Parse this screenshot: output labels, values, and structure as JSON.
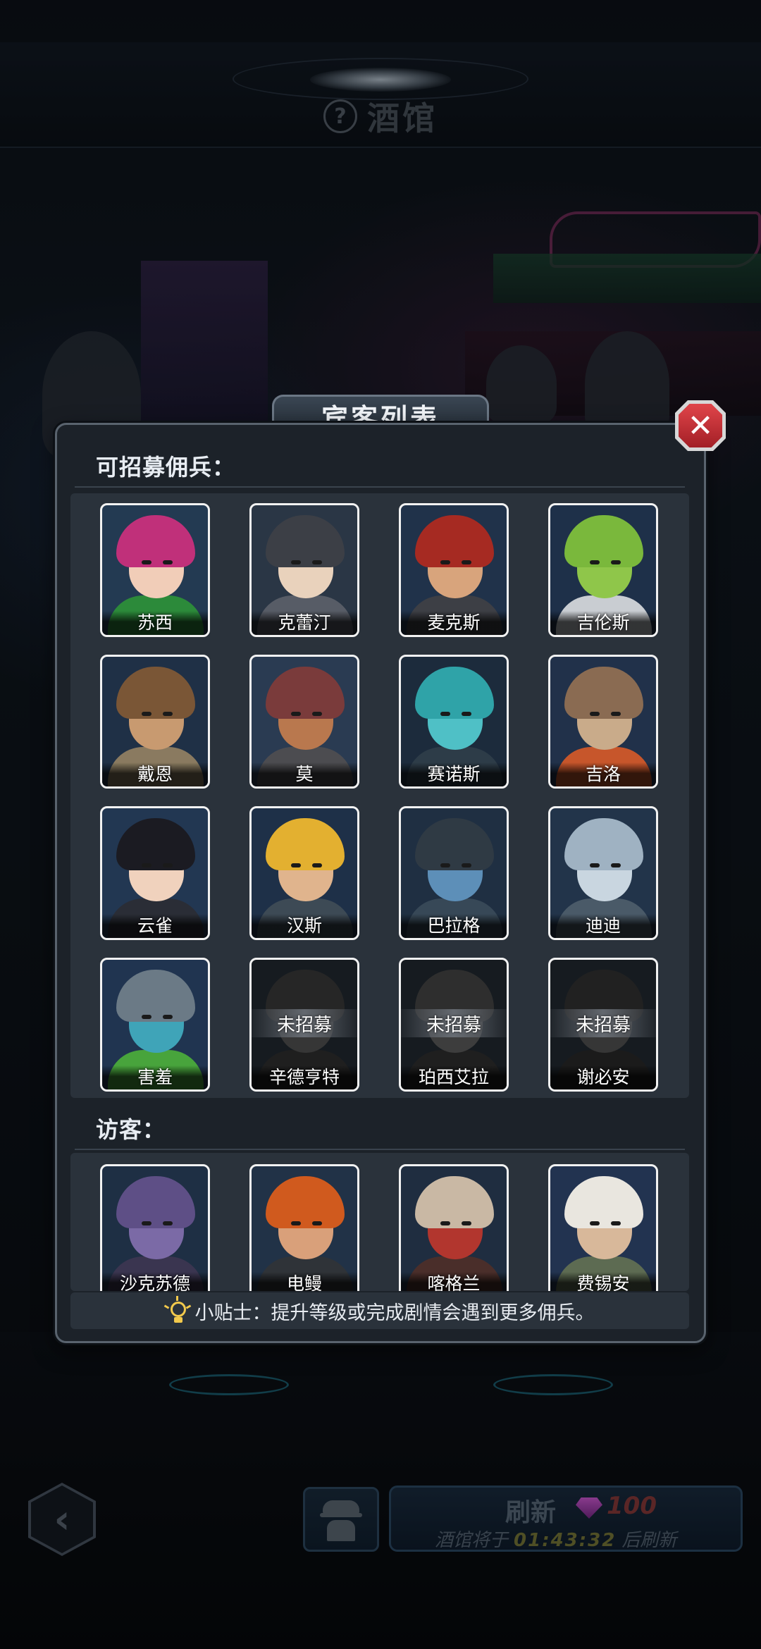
{
  "header": {
    "title": "酒馆",
    "help_icon": "question-mark-icon"
  },
  "modal": {
    "title": "宾客列表",
    "close_icon": "close-x-icon",
    "recruitable": {
      "heading": "可招募佣兵：",
      "items": [
        {
          "name": "苏西",
          "locked": false,
          "hair": "#c0307a",
          "skin": "#f1cdb8",
          "outfit": "#2c8a3a",
          "bg": "#233a52"
        },
        {
          "name": "克蕾汀",
          "locked": false,
          "hair": "#3c3f46",
          "skin": "#e9d2bc",
          "outfit": "#575c66",
          "bg": "#2a3645"
        },
        {
          "name": "麦克斯",
          "locked": false,
          "hair": "#a62a22",
          "skin": "#d8a47c",
          "outfit": "#3d3f45",
          "bg": "#20324a"
        },
        {
          "name": "吉伦斯",
          "locked": false,
          "hair": "#7ab83c",
          "skin": "#8fc64a",
          "outfit": "#c9cdd2",
          "bg": "#1e3049"
        },
        {
          "name": "戴恩",
          "locked": false,
          "hair": "#7a5636",
          "skin": "#c89a70",
          "outfit": "#8a7a60",
          "bg": "#1f3046"
        },
        {
          "name": "莫",
          "locked": false,
          "hair": "#7a3b3b",
          "skin": "#b9784e",
          "outfit": "#4c4c50",
          "bg": "#2a3b52"
        },
        {
          "name": "赛诺斯",
          "locked": false,
          "hair": "#2fa3a8",
          "skin": "#4fc0c6",
          "outfit": "#2d3c48",
          "bg": "#1c2b3c"
        },
        {
          "name": "吉洛",
          "locked": false,
          "hair": "#8a6b52",
          "skin": "#c9ab8a",
          "outfit": "#c7562b",
          "bg": "#21314a"
        },
        {
          "name": "云雀",
          "locked": false,
          "hair": "#1b1b22",
          "skin": "#f0d2bd",
          "outfit": "#2a2d36",
          "bg": "#223752"
        },
        {
          "name": "汉斯",
          "locked": false,
          "hair": "#e3b030",
          "skin": "#e0b48d",
          "outfit": "#3d4a55",
          "bg": "#1e3048"
        },
        {
          "name": "巴拉格",
          "locked": false,
          "hair": "#2f3a44",
          "skin": "#5d8fb8",
          "outfit": "#374857",
          "bg": "#1f2f42"
        },
        {
          "name": "迪迪",
          "locked": false,
          "hair": "#9fb2c2",
          "skin": "#c9d6e0",
          "outfit": "#4a5a68",
          "bg": "#22344a"
        },
        {
          "name": "害羞",
          "locked": false,
          "hair": "#6b7a86",
          "skin": "#3fa4b8",
          "outfit": "#48a43c",
          "bg": "#203450"
        },
        {
          "name": "辛德亨特",
          "locked": true,
          "status": "未招募",
          "hair": "#555555",
          "skin": "#777777",
          "outfit": "#444444",
          "bg": "#161b20"
        },
        {
          "name": "珀西艾拉",
          "locked": true,
          "status": "未招募",
          "hair": "#666666",
          "skin": "#888888",
          "outfit": "#444444",
          "bg": "#161b20"
        },
        {
          "name": "谢必安",
          "locked": true,
          "status": "未招募",
          "hair": "#4a4a4a",
          "skin": "#777777",
          "outfit": "#3d3d3d",
          "bg": "#161b20"
        }
      ]
    },
    "visitors": {
      "heading": "访客：",
      "items": [
        {
          "name": "沙克苏德",
          "hair": "#5e4f86",
          "skin": "#7b6aa6",
          "outfit": "#3a3550",
          "bg": "#1e2f44"
        },
        {
          "name": "电鳗",
          "hair": "#d05a1e",
          "skin": "#d9a07a",
          "outfit": "#2f3338",
          "bg": "#213247"
        },
        {
          "name": "喀格兰",
          "hair": "#c9b8a4",
          "skin": "#b2362e",
          "outfit": "#4a2e2a",
          "bg": "#1f2d40"
        },
        {
          "name": "费锡安",
          "hair": "#e9e6df",
          "skin": "#d8b89a",
          "outfit": "#5d6b52",
          "bg": "#223350"
        }
      ]
    },
    "tip": "小贴士：提升等级或完成剧情会遇到更多佣兵。",
    "tip_icon": "lightbulb-icon"
  },
  "bottom": {
    "back_icon": "chevron-left-icon",
    "spy_icon": "spy-icon",
    "refresh": {
      "label": "刷新",
      "cost": "100",
      "cost_icon": "gem-icon",
      "prefix": "酒馆将于",
      "timer": "01:43:32",
      "suffix": "后刷新"
    }
  },
  "colors": {
    "accent_close": "#c5282e",
    "card_border": "#f2f2f2",
    "panel": "#2a323b",
    "tip_icon": "#f2c94c"
  }
}
